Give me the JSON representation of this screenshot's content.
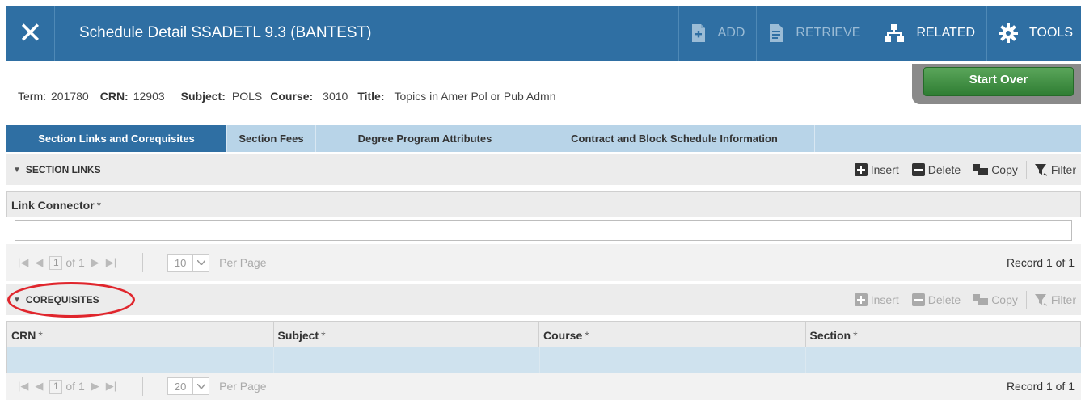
{
  "header": {
    "close_symbol": "✕",
    "title": "Schedule Detail SSADETL 9.3 (BANTEST)",
    "buttons": [
      {
        "label": "ADD",
        "icon": "add-document-icon",
        "disabled": true
      },
      {
        "label": "RETRIEVE",
        "icon": "retrieve-document-icon",
        "disabled": true
      },
      {
        "label": "RELATED",
        "icon": "related-hierarchy-icon",
        "disabled": false
      },
      {
        "label": "TOOLS",
        "icon": "gear-icon",
        "disabled": false
      }
    ],
    "colors": {
      "bar": "#2f6fa3"
    }
  },
  "key_block": {
    "term_label": "Term:",
    "term_value": "201780",
    "crn_label": "CRN:",
    "crn_value": "12903",
    "subject_label": "Subject:",
    "subject_value": "POLS",
    "course_label": "Course:",
    "course_value": "3010",
    "title_label": "Title:",
    "title_value": "Topics in Amer Pol or Pub Admn",
    "start_over": "Start Over"
  },
  "tabs": [
    {
      "label": "Section Links and Corequisites",
      "active": true
    },
    {
      "label": "Section Fees",
      "active": false
    },
    {
      "label": "Degree Program Attributes",
      "active": false
    },
    {
      "label": "Contract and Block Schedule Information",
      "active": false
    }
  ],
  "actions": {
    "insert": "Insert",
    "delete": "Delete",
    "copy": "Copy",
    "filter": "Filter"
  },
  "section_links": {
    "title": "SECTION LINKS",
    "column": "Link Connector",
    "required_mark": "*",
    "pager": {
      "page": "1",
      "of": "of 1",
      "per_page": "10",
      "per_page_label": "Per Page",
      "record": "Record 1 of 1"
    }
  },
  "corequisites": {
    "title": "COREQUISITES",
    "columns": [
      "CRN",
      "Subject",
      "Course",
      "Section"
    ],
    "required_mark": "*",
    "pager": {
      "page": "1",
      "of": "of 1",
      "per_page": "20",
      "per_page_label": "Per Page",
      "record": "Record 1 of 1"
    }
  }
}
